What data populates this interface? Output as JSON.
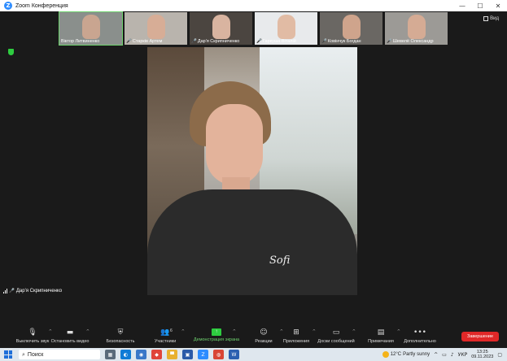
{
  "window": {
    "title": "Zoom Конференция",
    "controls": {
      "minimize": "—",
      "maximize": "☐",
      "close": "✕"
    }
  },
  "gallery": [
    {
      "name": "Віктор Литвиненко",
      "muted": false,
      "bg": "#8a8f8c",
      "face": "#c9a590"
    },
    {
      "name": "Старків Артем",
      "muted": true,
      "bg": "#b9b4ad",
      "face": "#d7ad96"
    },
    {
      "name": "Дар'я Скрипниченко",
      "muted": true,
      "bg": "#4b4540",
      "face": "#d9b4a0"
    },
    {
      "name": "Гаркуша Віталій",
      "muted": true,
      "bg": "#e8eaec",
      "face": "#e1bba4"
    },
    {
      "name": "Ковінчук Богдан",
      "muted": true,
      "bg": "#6a6763",
      "face": "#cfa48c"
    },
    {
      "name": "Шевелё Олександр",
      "muted": true,
      "bg": "#9c9a96",
      "face": "#d5ab94"
    }
  ],
  "view_label": "Вид",
  "main_print": "Sofi",
  "speaker": {
    "name": "Дар'я Скрипниченко"
  },
  "toolbar": {
    "items": [
      {
        "icon": "🎙",
        "label": "Выключить звук",
        "caret": "^"
      },
      {
        "icon": "▬",
        "label": "Остановить видео",
        "caret": "^"
      },
      {
        "icon": "⛨",
        "label": "Безопасность",
        "caret": ""
      },
      {
        "icon": "👥",
        "label": "Участники",
        "count": "6",
        "caret": "^"
      },
      {
        "icon": "↑",
        "label": "Демонстрация экрана",
        "caret": "^"
      },
      {
        "icon": "☺",
        "label": "Реакции",
        "caret": "^"
      },
      {
        "icon": "⊞",
        "label": "Приложения",
        "caret": "^"
      },
      {
        "icon": "▭",
        "label": "Доски сообщений",
        "caret": "^"
      },
      {
        "icon": "▤",
        "label": "Примечания",
        "caret": "^"
      },
      {
        "icon": "•••",
        "label": "Дополнительно",
        "caret": ""
      }
    ],
    "end_label": "Завершение"
  },
  "taskbar": {
    "search_placeholder": "Поиск",
    "apps": [
      {
        "glyph": "▦",
        "color": "#5a6a7a"
      },
      {
        "glyph": "◐",
        "color": "#0f7bd6"
      },
      {
        "glyph": "◉",
        "color": "#3a78c8"
      },
      {
        "glyph": "◆",
        "color": "#e0453a"
      },
      {
        "glyph": "▀",
        "color": "#e8b130"
      },
      {
        "glyph": "▣",
        "color": "#2b5aa8"
      },
      {
        "glyph": "Z",
        "color": "#2d8cff"
      },
      {
        "glyph": "◍",
        "color": "#d94535"
      },
      {
        "glyph": "W",
        "color": "#2b5fb0"
      }
    ],
    "weather": {
      "temp": "12°C",
      "desc": "Partly sunny"
    },
    "lang": "УКР",
    "time": "13:25",
    "date": "09.11.2023"
  }
}
